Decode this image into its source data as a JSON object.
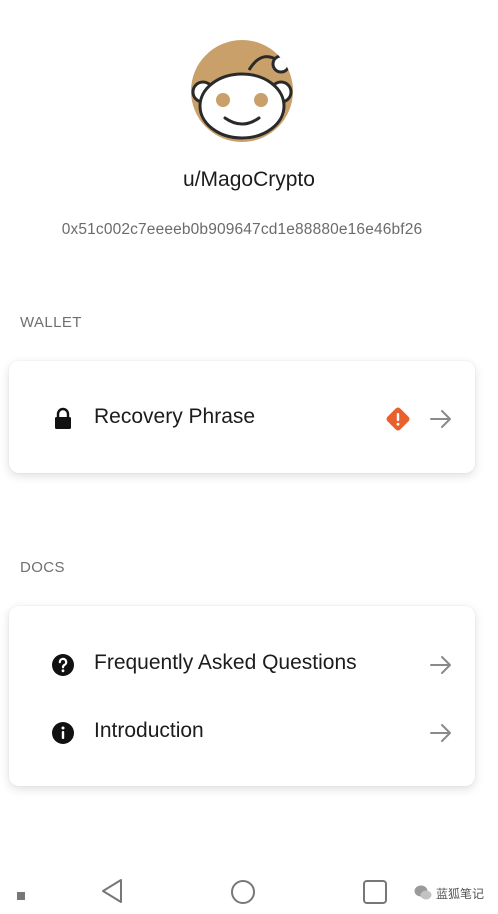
{
  "profile": {
    "username": "u/MagoCrypto",
    "address": "0x51c002c7eeeeb0b909647cd1e88880e16e46bf26",
    "avatar_bg": "#c9a06a"
  },
  "wallet": {
    "section_label": "WALLET",
    "items": [
      {
        "label": "Recovery Phrase",
        "icon": "lock-icon",
        "badge": "warning-diamond-icon",
        "badge_color": "#e8602c"
      }
    ]
  },
  "docs": {
    "section_label": "DOCS",
    "items": [
      {
        "label": "Frequently Asked Questions",
        "icon": "question-circle-icon"
      },
      {
        "label": "Introduction",
        "icon": "info-circle-icon"
      }
    ]
  },
  "watermark": {
    "text": "蓝狐笔记"
  }
}
